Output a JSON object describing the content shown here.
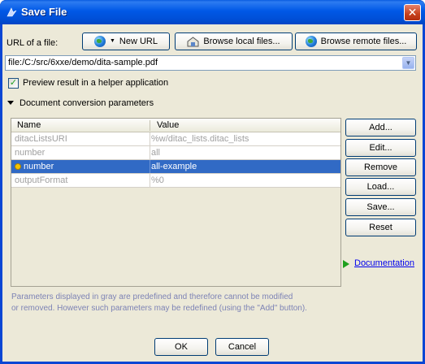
{
  "window": {
    "title": "Save File",
    "close_glyph": "✕"
  },
  "url_section": {
    "label": "URL of a file:",
    "new_url_label": "New URL",
    "browse_local_label": "Browse local files...",
    "browse_remote_label": "Browse remote files...",
    "url_value": "file:/C:/src/6xxe/demo/dita-sample.pdf"
  },
  "preview": {
    "checked": true,
    "label": "Preview result in a helper application"
  },
  "params_section": {
    "label": "Document conversion parameters"
  },
  "params_table": {
    "columns": [
      "Name",
      "Value"
    ],
    "rows": [
      {
        "name": "ditacListsURI",
        "value": "%w/ditac_lists.ditac_lists",
        "selected": false,
        "custom": false
      },
      {
        "name": "number",
        "value": "all",
        "selected": false,
        "custom": false
      },
      {
        "name": "number",
        "value": "all-example",
        "selected": true,
        "custom": true
      },
      {
        "name": "outputFormat",
        "value": "%0",
        "selected": false,
        "custom": false
      }
    ]
  },
  "side_buttons": {
    "add": "Add...",
    "edit": "Edit...",
    "remove": "Remove",
    "load": "Load...",
    "save": "Save...",
    "reset": "Reset"
  },
  "documentation_link": "Documentation",
  "note": {
    "line1": "Parameters displayed in gray are predefined and therefore cannot be modified",
    "line2": "or removed. However such parameters may be redefined (using the \"Add\" button)."
  },
  "footer": {
    "ok_label": "OK",
    "cancel_label": "Cancel"
  },
  "colors": {
    "selection": "#316ac5",
    "titlebar": "#0058e6",
    "dialog_bg": "#ece9d8",
    "note_text": "#7d83b5"
  }
}
